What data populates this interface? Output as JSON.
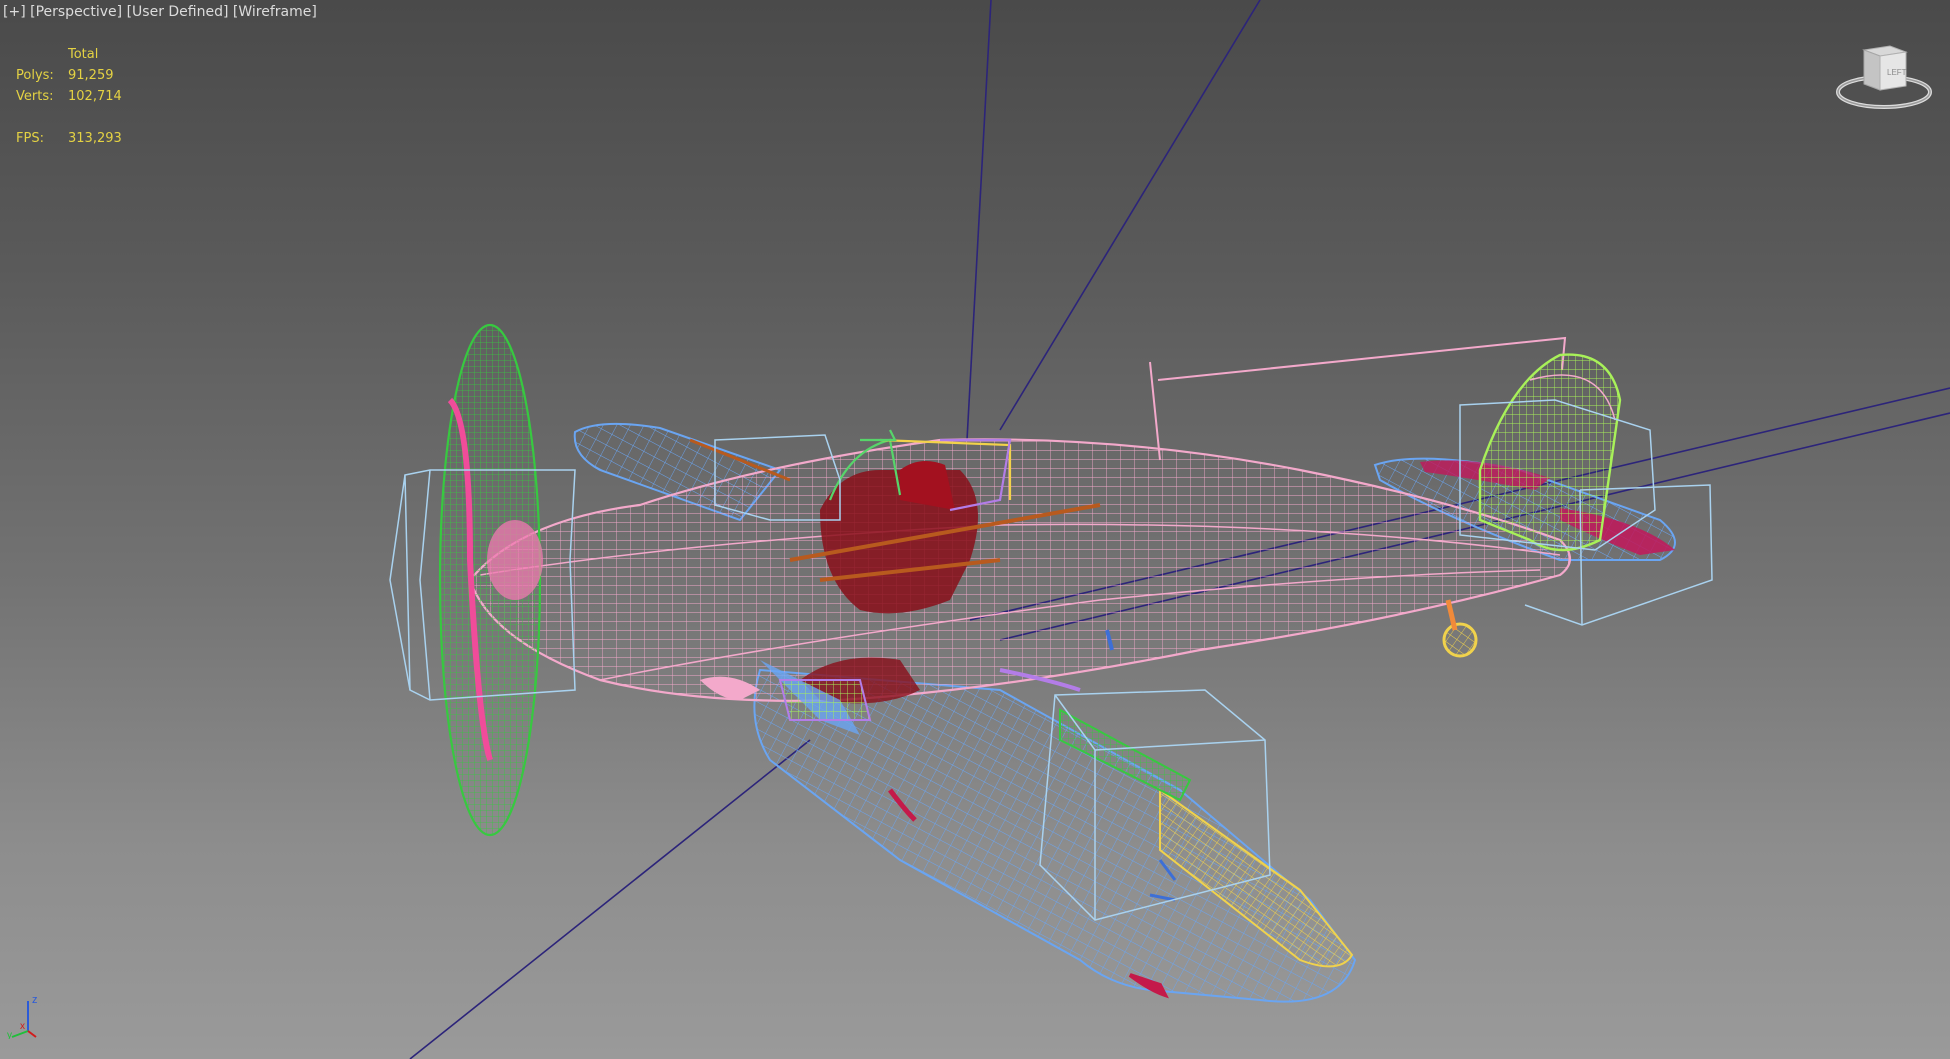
{
  "viewport": {
    "label_plus": "[+]",
    "label_view": "[Perspective]",
    "label_mode": "[User Defined]",
    "label_shading": "[Wireframe]"
  },
  "stats": {
    "header": "Total",
    "polys_label": "Polys:",
    "polys_value": "91,259",
    "verts_label": "Verts:",
    "verts_value": "102,714",
    "fps_label": "FPS:",
    "fps_value": "313,293",
    "color": "#e4d243"
  },
  "viewcube": {
    "face_label": "LEFT"
  },
  "axis_tripod": {
    "x": "x",
    "y": "y",
    "z": "z"
  },
  "colors": {
    "fuselage": "#f1a5c8",
    "propeller": "#36c93f",
    "wing": "#6aa3f0",
    "tail": "#a9f05a",
    "bbox": "#a9d2ef",
    "interior": "#8a0f1a",
    "accent_yellow": "#f2d24a",
    "axis_line": "#2c247a"
  }
}
